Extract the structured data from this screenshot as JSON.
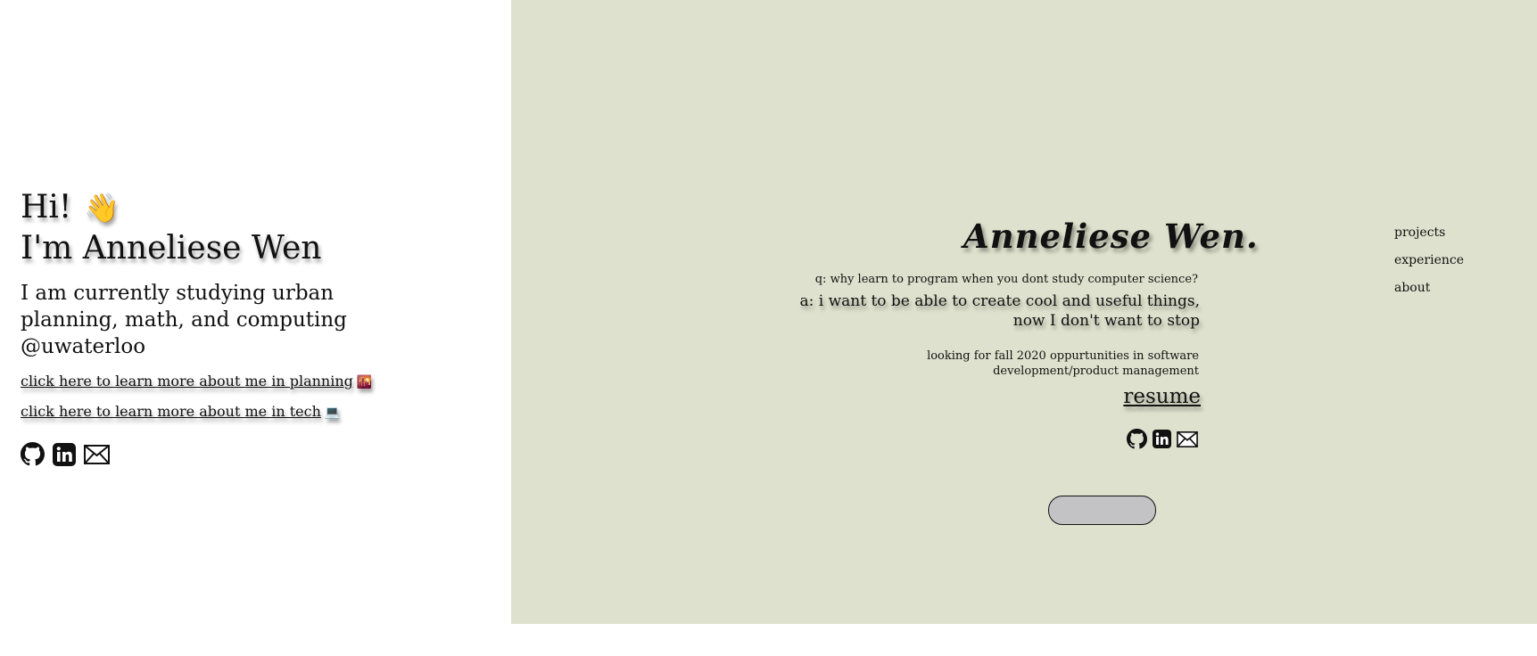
{
  "intro": {
    "greeting": "Hi!",
    "wave_emoji": "👋",
    "name_line": "I'm Anneliese Wen",
    "bio": "I am currently studying urban planning, math, and computing @uwaterloo",
    "link_planning": "click here to learn more about me in planning",
    "link_planning_emoji": "🌇",
    "link_tech": "click here to learn more about me in tech",
    "link_tech_emoji": "💻",
    "social_icons": [
      "github-icon",
      "linkedin-icon",
      "mail-icon"
    ]
  },
  "panel": {
    "brand": "Anneliese Wen.",
    "question": "q: why learn to program when you dont study computer science?",
    "answer": "a: i want to be able to create cool and useful things, now I don't want to stop",
    "looking": "looking for fall 2020 oppurtunities in software development/product management",
    "resume": "resume",
    "social_icons": [
      "github-icon",
      "linkedin-icon",
      "mail-icon"
    ],
    "background_color": "#dee1cd",
    "button_color": "#c3c3c5"
  },
  "nav": {
    "items": [
      {
        "label": "projects"
      },
      {
        "label": "experience"
      },
      {
        "label": "about"
      }
    ]
  }
}
